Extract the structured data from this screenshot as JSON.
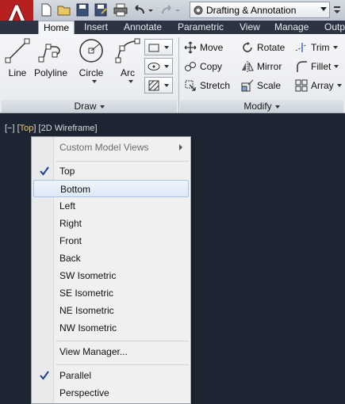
{
  "toolbar": {
    "workspace": "Drafting & Annotation"
  },
  "tabs": [
    {
      "label": "Home",
      "active": true
    },
    {
      "label": "Insert"
    },
    {
      "label": "Annotate"
    },
    {
      "label": "Parametric"
    },
    {
      "label": "View"
    },
    {
      "label": "Manage"
    },
    {
      "label": "Outp"
    }
  ],
  "ribbon": {
    "draw": {
      "title": "Draw",
      "tools": [
        {
          "label": "Line",
          "icon": "line-icon"
        },
        {
          "label": "Polyline",
          "icon": "polyline-icon"
        },
        {
          "label": "Circle",
          "icon": "circle-icon"
        },
        {
          "label": "Arc",
          "icon": "arc-icon"
        }
      ]
    },
    "modify": {
      "title": "Modify",
      "tools": [
        {
          "label": "Move",
          "icon": "move-icon"
        },
        {
          "label": "Rotate",
          "icon": "rotate-icon"
        },
        {
          "label": "Trim",
          "icon": "trim-icon"
        },
        {
          "label": "Copy",
          "icon": "copy-icon"
        },
        {
          "label": "Mirror",
          "icon": "mirror-icon"
        },
        {
          "label": "Fillet",
          "icon": "fillet-icon"
        },
        {
          "label": "Stretch",
          "icon": "stretch-icon"
        },
        {
          "label": "Scale",
          "icon": "scale-icon"
        },
        {
          "label": "Array",
          "icon": "array-icon"
        }
      ]
    }
  },
  "viewport": {
    "controls": "[−]",
    "view": "Top",
    "style": "[2D Wireframe]"
  },
  "menu": {
    "items": [
      {
        "label": "Custom Model Views",
        "disabled": true,
        "submenu": true
      },
      {
        "label": "Top",
        "checked": true
      },
      {
        "label": "Bottom",
        "hover": true
      },
      {
        "label": "Left"
      },
      {
        "label": "Right"
      },
      {
        "label": "Front"
      },
      {
        "label": "Back"
      },
      {
        "label": "SW Isometric"
      },
      {
        "label": "SE Isometric"
      },
      {
        "label": "NE Isometric"
      },
      {
        "label": "NW Isometric"
      },
      {
        "label": "View Manager..."
      },
      {
        "label": "Parallel",
        "checked": true
      },
      {
        "label": "Perspective"
      }
    ]
  },
  "colors": {
    "accent": "#d62b2b",
    "viewport_bg": "#1e2532",
    "view_name": "#e7c96a",
    "check": "#1d3f8f"
  }
}
